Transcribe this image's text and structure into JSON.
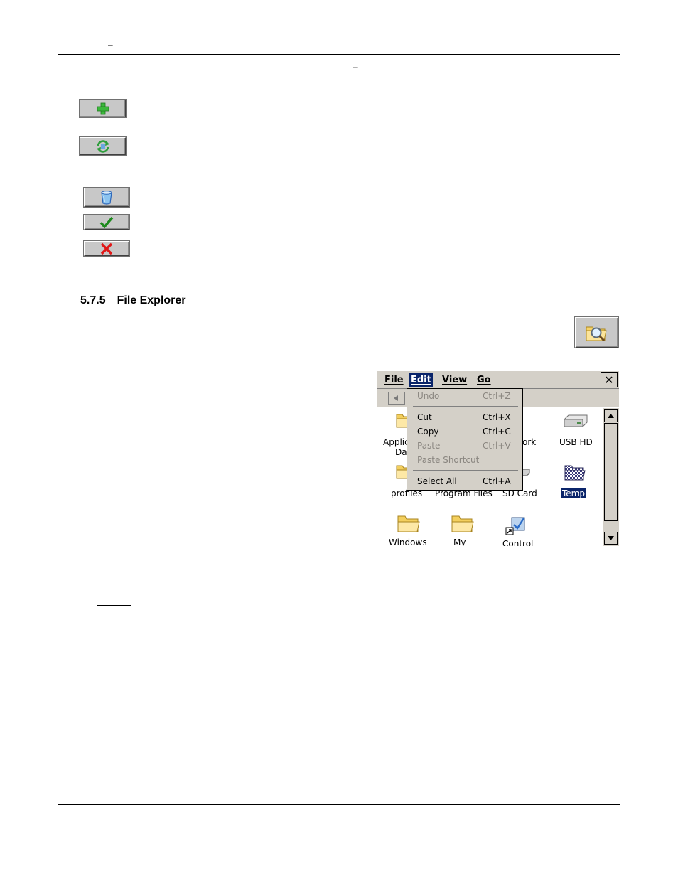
{
  "header": {
    "dash_left": "–",
    "dash_center": "–"
  },
  "section": {
    "number": "5.7.5",
    "title": "File Explorer"
  },
  "document_buttons": [
    {
      "name": "add",
      "icon": "green-plus-icon"
    },
    {
      "name": "refresh",
      "icon": "green-refresh-icon"
    },
    {
      "name": "clear",
      "icon": "blue-bucket-icon"
    },
    {
      "name": "ok",
      "icon": "green-check-icon"
    },
    {
      "name": "cancel",
      "icon": "red-x-icon"
    },
    {
      "name": "file-explorer",
      "icon": "folder-magnifier-icon"
    }
  ],
  "explorer": {
    "menus": [
      {
        "label": "File",
        "active": false
      },
      {
        "label": "Edit",
        "active": true
      },
      {
        "label": "View",
        "active": false
      },
      {
        "label": "Go",
        "active": false
      }
    ],
    "close_glyph": "✕",
    "edit_menu": {
      "undo": {
        "label": "Undo",
        "shortcut": "Ctrl+Z",
        "enabled": false
      },
      "cut": {
        "label": "Cut",
        "shortcut": "Ctrl+X",
        "enabled": true
      },
      "copy": {
        "label": "Copy",
        "shortcut": "Ctrl+C",
        "enabled": true
      },
      "paste": {
        "label": "Paste",
        "shortcut": "Ctrl+V",
        "enabled": false
      },
      "paste_shortcut": {
        "label": "Paste Shortcut",
        "shortcut": "",
        "enabled": false
      },
      "select_all": {
        "label": "Select All",
        "shortcut": "Ctrl+A",
        "enabled": true
      }
    },
    "items": {
      "appdata_1": "Applic",
      "appdata_2": "Da",
      "network": "ork",
      "usb": "USB HD",
      "profiles": "profiles",
      "program_files": "Program Files",
      "sd_card": "SD Card",
      "temp": "Temp",
      "windows": "Windows",
      "my": "My",
      "control": "Control"
    }
  },
  "colors": {
    "selection": "#0a246a",
    "chrome": "#d4d0c8"
  }
}
